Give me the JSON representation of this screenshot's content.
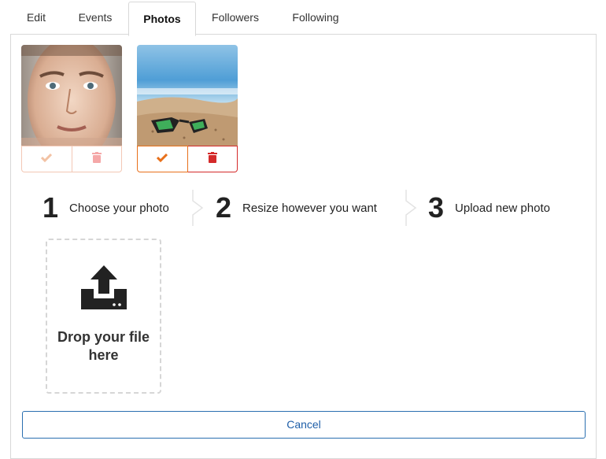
{
  "tabs": [
    {
      "label": "Edit"
    },
    {
      "label": "Events"
    },
    {
      "label": "Photos"
    },
    {
      "label": "Followers"
    },
    {
      "label": "Following"
    }
  ],
  "active_tab": "Photos",
  "photos": [
    {
      "description": "portrait",
      "approve_icon": "check-icon",
      "delete_icon": "trash-icon",
      "state": "faded"
    },
    {
      "description": "sunglasses",
      "approve_icon": "check-icon",
      "delete_icon": "trash-icon",
      "state": "active"
    }
  ],
  "steps": [
    {
      "number": "1",
      "label": "Choose your photo"
    },
    {
      "number": "2",
      "label": "Resize however you want"
    },
    {
      "number": "3",
      "label": "Upload new photo"
    }
  ],
  "dropzone": {
    "text": "Drop your file here",
    "icon": "upload-icon"
  },
  "cancel_label": "Cancel",
  "colors": {
    "accent_orange": "#e8701a",
    "delete_red": "#d42a2a",
    "cancel_blue": "#1f5fa8"
  }
}
